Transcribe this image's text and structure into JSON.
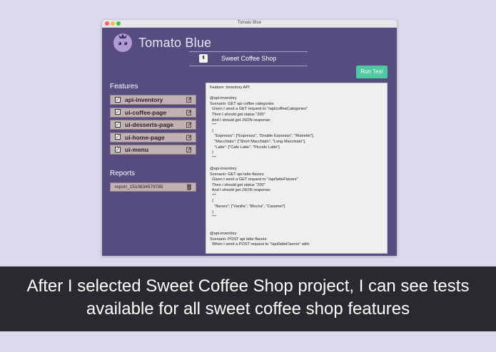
{
  "window": {
    "title": "Tomato Blue",
    "app_title": "Tomato Blue"
  },
  "project_select": {
    "value": "Sweet Coffee Shop",
    "icon": "chevron-updown-icon"
  },
  "run_button": {
    "label": "Run Test",
    "color": "#4ec9a0"
  },
  "features": {
    "label": "Features",
    "items": [
      {
        "name": "api-inventory",
        "checked": true
      },
      {
        "name": "ui-coffee-page",
        "checked": true
      },
      {
        "name": "ui-desserts-page",
        "checked": true
      },
      {
        "name": "ui-home-page",
        "checked": true
      },
      {
        "name": "ui-menu",
        "checked": true
      }
    ]
  },
  "reports": {
    "label": "Reports",
    "items": [
      {
        "name": "report_1510634579785"
      }
    ]
  },
  "editor": {
    "content": "Feature: Inventory API\n\n@api-inventory\nScenario: GET api coffee categories\n  Given I send a GET request to \"/api/coffeeCategories\"\n  Then I should get status \"200\"\n  And I should get JSON response:\n  \"\"\"\n  {\n    \"Espresso\": [\"Espresso\", \"Double Espresso\", \"Ristretto\"],\n    \"Macchiato\": [\"Short Macchiato\", \"Long Macchiato\"],\n    \"Latte\": [\"Cafe Latte\", \"Piccolo Latte\"]\n  }\n  \"\"\"\n\n@api-inventory\nScenario: GET api latte flavors\n  Given I send a GET request to \"/api/latteFlavors\"\n  Then I should get status \"200\"\n  And I should get JSON response:\n  \"\"\"\n  {\n    \"flavors\": [\"Vanilla\", \"Mocha\", \"Caramel\"]\n  }\n  \"\"\"\n\n\n@api-inventory\nScenario: POST api latte flavors\n  When I send a POST request to \"/api/latteFlavors\" with:"
  },
  "caption": {
    "text": "After I selected Sweet Coffee Shop project, I can see tests available for all sweet coffee shop features"
  },
  "colors": {
    "window_bg": "#574c80",
    "list_item_bg": "#c1b1b3",
    "caption_bg": "#2b292e"
  }
}
